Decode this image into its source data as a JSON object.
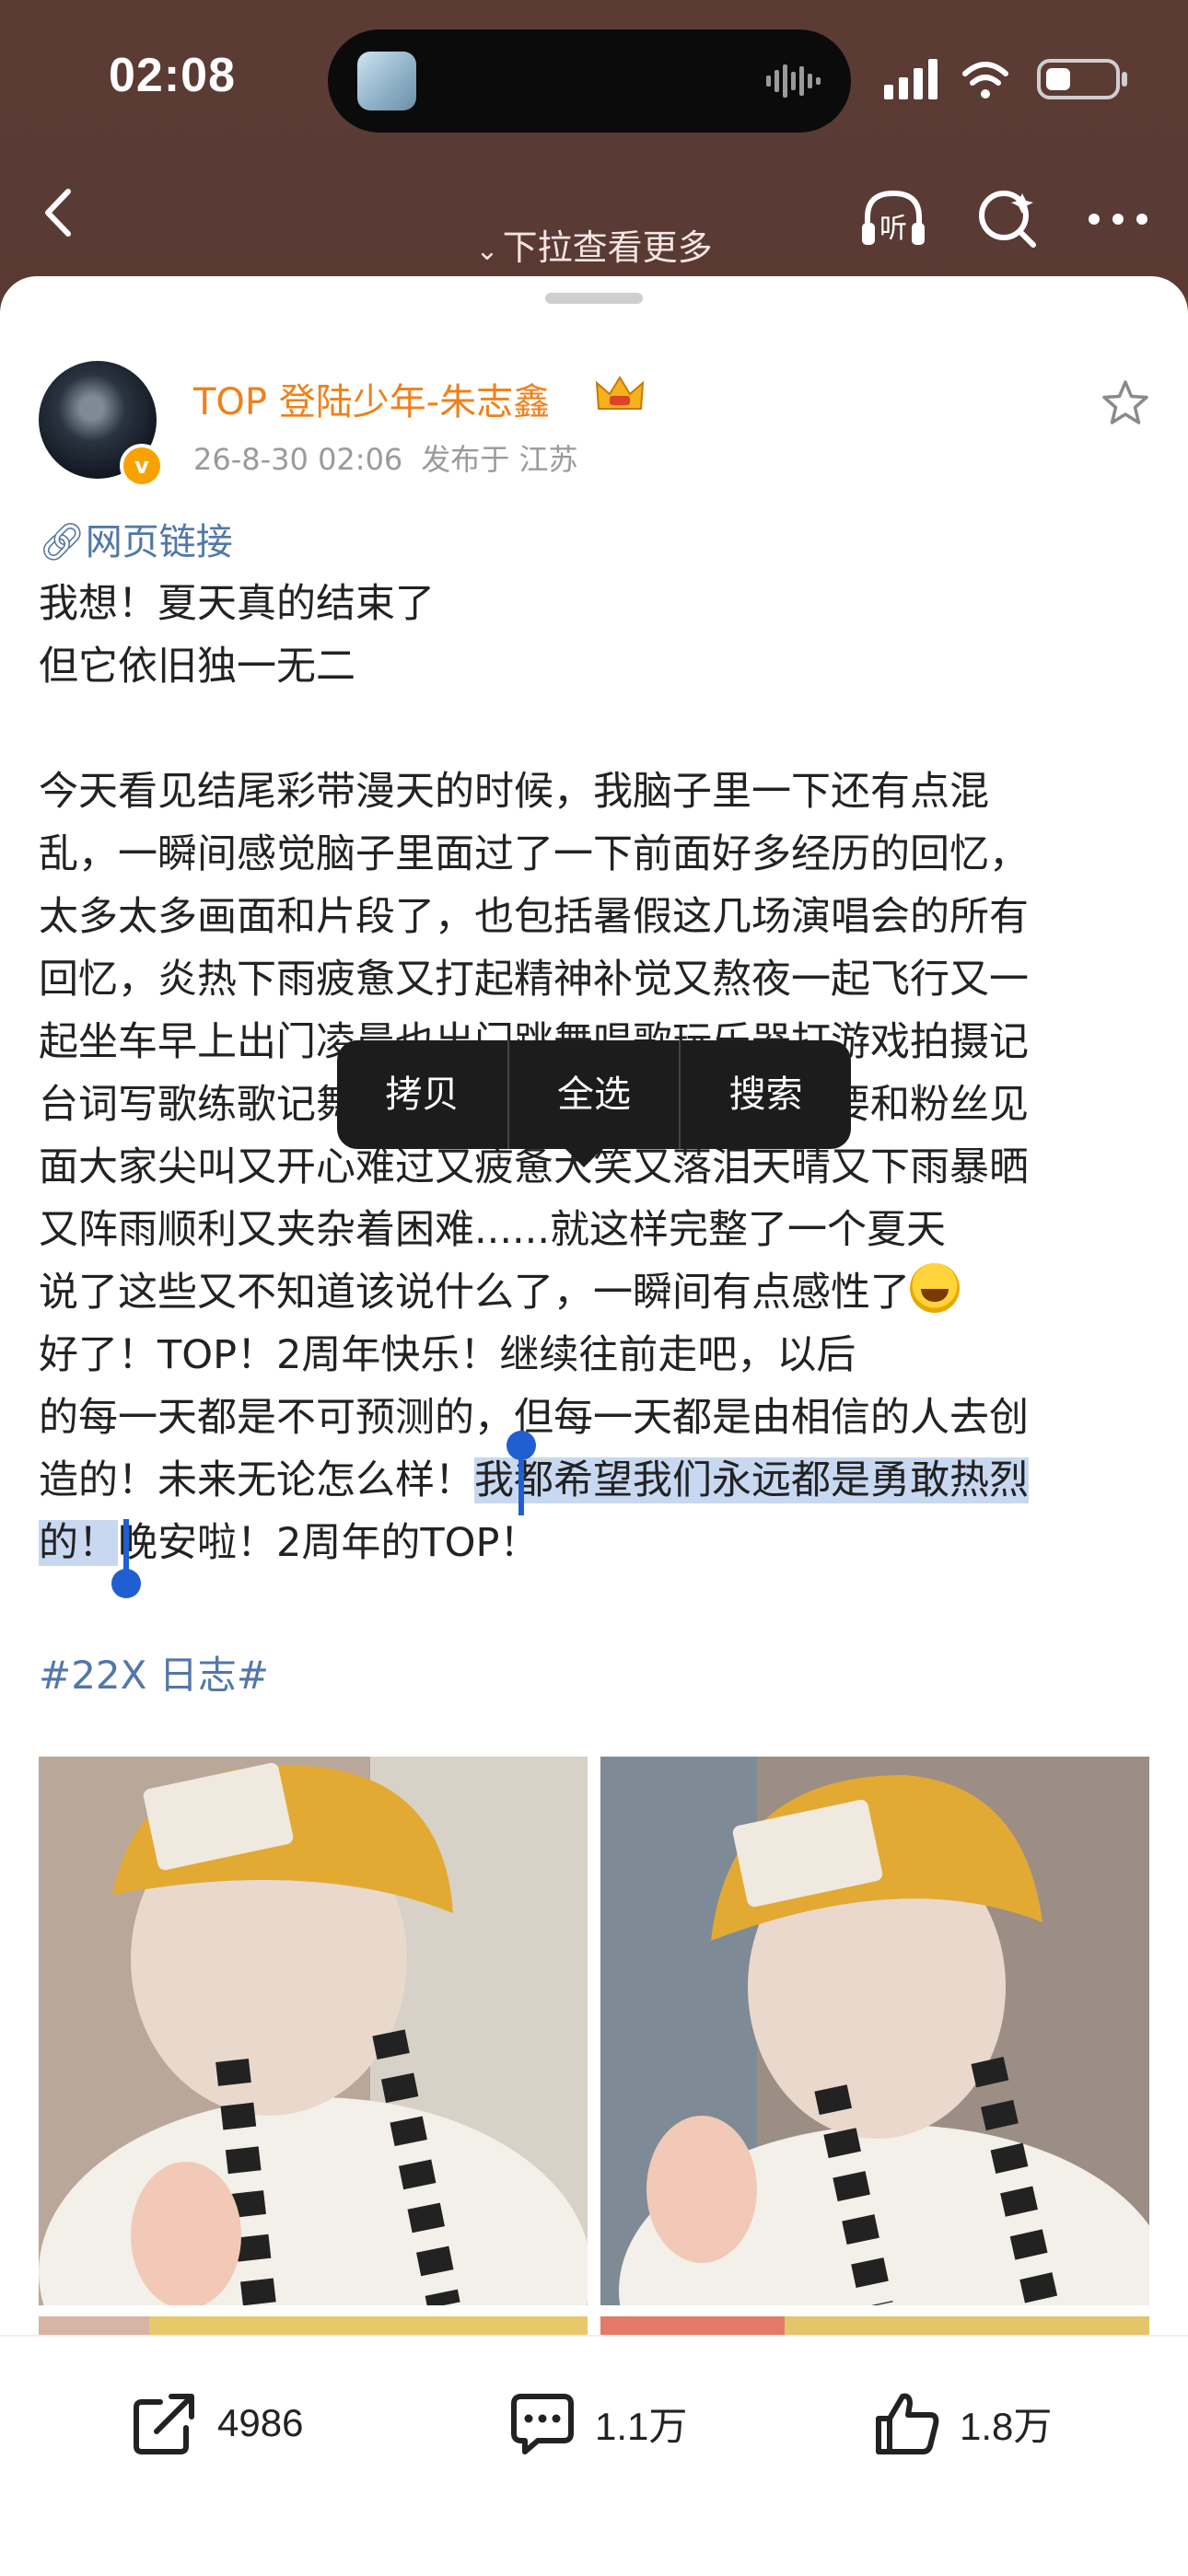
{
  "status": {
    "time": "02:08"
  },
  "header": {
    "pull_hint": "下拉查看更多"
  },
  "post": {
    "author": "TOP 登陆少年-朱志鑫",
    "timestamp": "26-8-30 02:06",
    "location": "发布于 江苏",
    "web_link": "网页链接",
    "lines": {
      "l1": "我想！夏天真的结束了",
      "l2": "但它依旧独一无二",
      "l3": "今天看见结尾彩带漫天的时候，我脑子里一下还有点混",
      "l4": "乱，一瞬间感觉脑子里面过了一下前面好多经历的回忆，",
      "l5": "太多太多画面和片段了，也包括暑假这几场演唱会的所有",
      "l6": "回忆，炎热下雨疲惫又打起精神补觉又熬夜一起飞行又一",
      "l7": "起坐车早上出门凌晨也出门跳舞唱歌玩乐器打游戏拍摄记",
      "l8": "台词写歌练歌记舞开心又会沮丧化了妆又卸妆要和粉丝见",
      "l9": "面大家尖叫又开心难过又疲惫大笑又落泪天晴又下雨暴晒",
      "l10": "又阵雨顺利又夹杂着困难......就这样完整了一个夏天",
      "l11": "说了这些又不知道该说什么了，一瞬间有点感性了",
      "l12": "好了！TOP！2周年快乐！继续往前走吧，以后",
      "l13": "的每一天都是不可预测的，但每一天都是由相信的人去创",
      "l14a": "造的！未来无论怎么样！",
      "l14b": "我都希望我们永远都是勇敢热烈",
      "l15a": "的！",
      "l15b": "晚安啦！2周年的TOP！"
    },
    "hashtag": "#22X 日志#"
  },
  "context_menu": {
    "copy": "拷贝",
    "select_all": "全选",
    "search": "搜索"
  },
  "actions": {
    "repost_count": "4986",
    "comment_count": "1.1万",
    "like_count": "1.8万"
  },
  "colors": {
    "accent_name": "#f0801a",
    "link": "#5277a8",
    "selection": "#c9d8f1",
    "handle": "#1f5fd1"
  }
}
